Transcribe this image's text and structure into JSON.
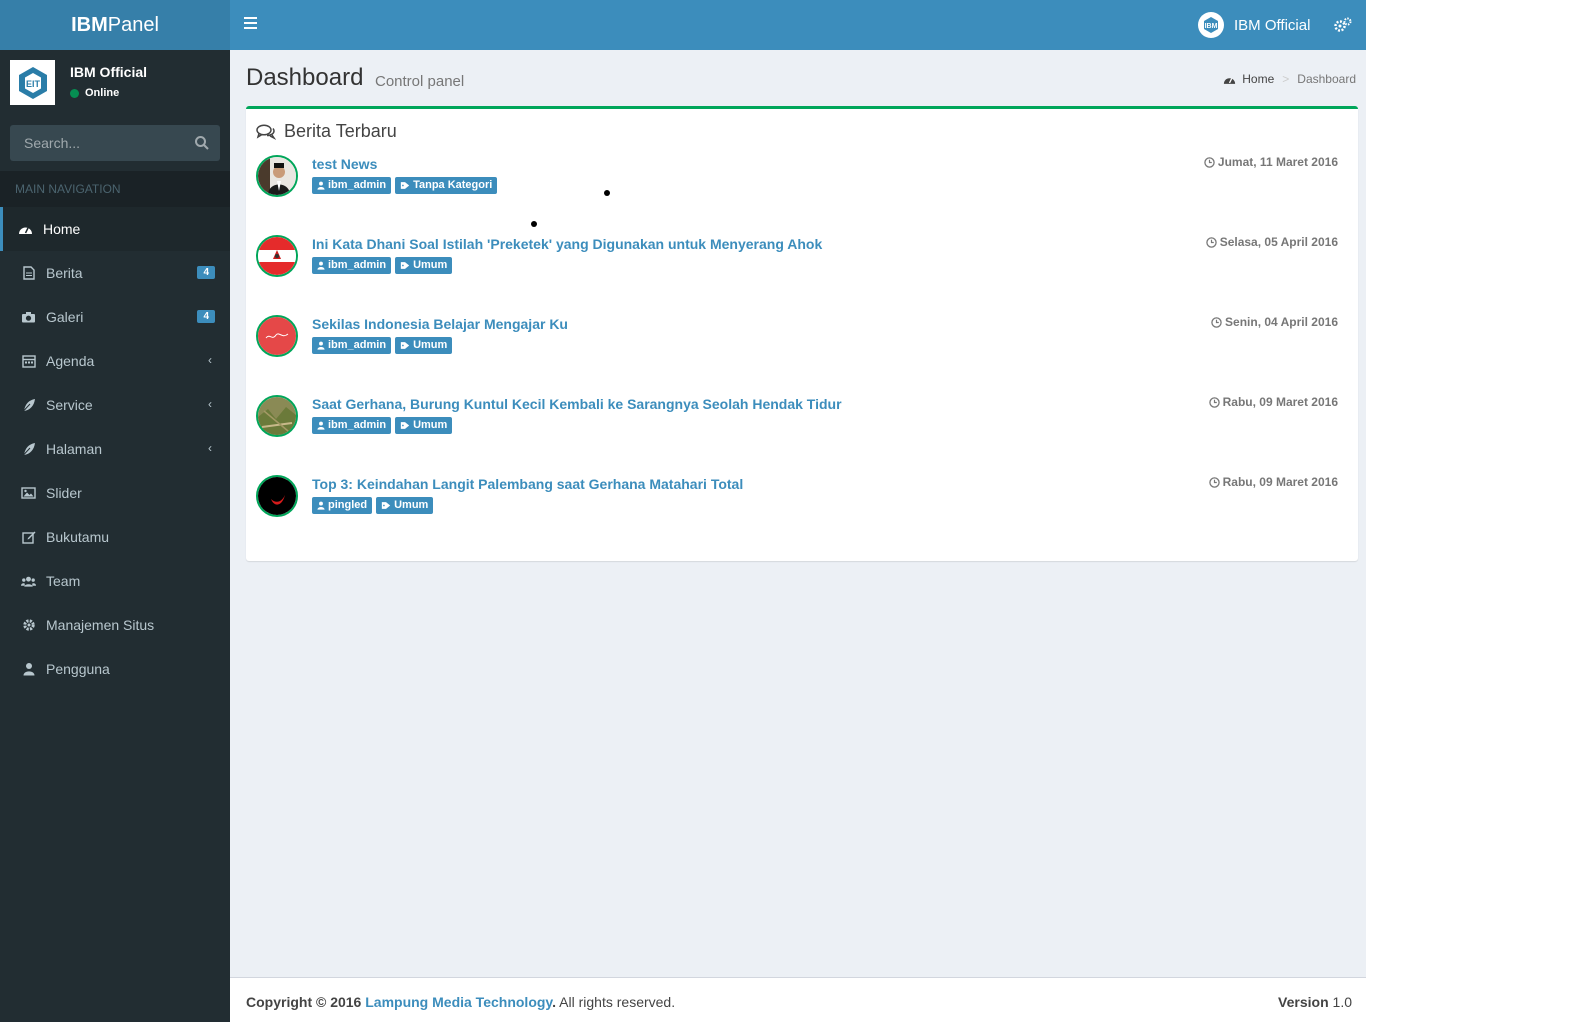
{
  "brand": {
    "bold": "IBM",
    "light": "Panel"
  },
  "header": {
    "user_name": "IBM Official"
  },
  "sidebar": {
    "user_name": "IBM Official",
    "status": "Online",
    "search_placeholder": "Search...",
    "nav_header": "MAIN NAVIGATION",
    "items": [
      {
        "label": "Home",
        "icon": "dashboard-icon"
      },
      {
        "label": "Berita",
        "icon": "file-text-icon",
        "badge": "4"
      },
      {
        "label": "Galeri",
        "icon": "camera-icon",
        "badge": "4"
      },
      {
        "label": "Agenda",
        "icon": "calendar-icon"
      },
      {
        "label": "Service",
        "icon": "leaf-icon"
      },
      {
        "label": "Halaman",
        "icon": "leaf-icon"
      },
      {
        "label": "Slider",
        "icon": "picture-icon"
      },
      {
        "label": "Bukutamu",
        "icon": "edit-icon"
      },
      {
        "label": "Team",
        "icon": "users-icon"
      },
      {
        "label": "Manajemen Situs",
        "icon": "gear-icon"
      },
      {
        "label": "Pengguna",
        "icon": "user-icon"
      }
    ]
  },
  "content": {
    "title": "Dashboard",
    "subtitle": "Control panel",
    "breadcrumb": {
      "home": "Home",
      "current": "Dashboard"
    }
  },
  "box": {
    "title": "Berita Terbaru",
    "news": [
      {
        "title": "test News",
        "author": "ibm_admin",
        "category": "Tanpa Kategori",
        "date": "Jumat, 11 Maret 2016"
      },
      {
        "title": "Ini Kata Dhani Soal Istilah 'Preketek' yang Digunakan untuk Menyerang Ahok",
        "author": "ibm_admin",
        "category": "Umum",
        "date": "Selasa, 05 April 2016"
      },
      {
        "title": "Sekilas Indonesia Belajar Mengajar Ku",
        "author": "ibm_admin",
        "category": "Umum",
        "date": "Senin, 04 April 2016"
      },
      {
        "title": "Saat Gerhana, Burung Kuntul Kecil Kembali ke Sarangnya Seolah Hendak Tidur",
        "author": "ibm_admin",
        "category": "Umum",
        "date": "Rabu, 09 Maret 2016"
      },
      {
        "title": "Top 3: Keindahan Langit Palembang saat Gerhana Matahari Total",
        "author": "pingled",
        "category": "Umum",
        "date": "Rabu, 09 Maret 2016"
      }
    ]
  },
  "footer": {
    "copyright": "Copyright © 2016",
    "company": "Lampung Media Technology",
    "rights": ". All rights reserved.",
    "version_label": "Version",
    "version": "1.0"
  },
  "colors": {
    "primary": "#3c8dbc",
    "sidebar": "#222d32",
    "success": "#00a65a"
  }
}
